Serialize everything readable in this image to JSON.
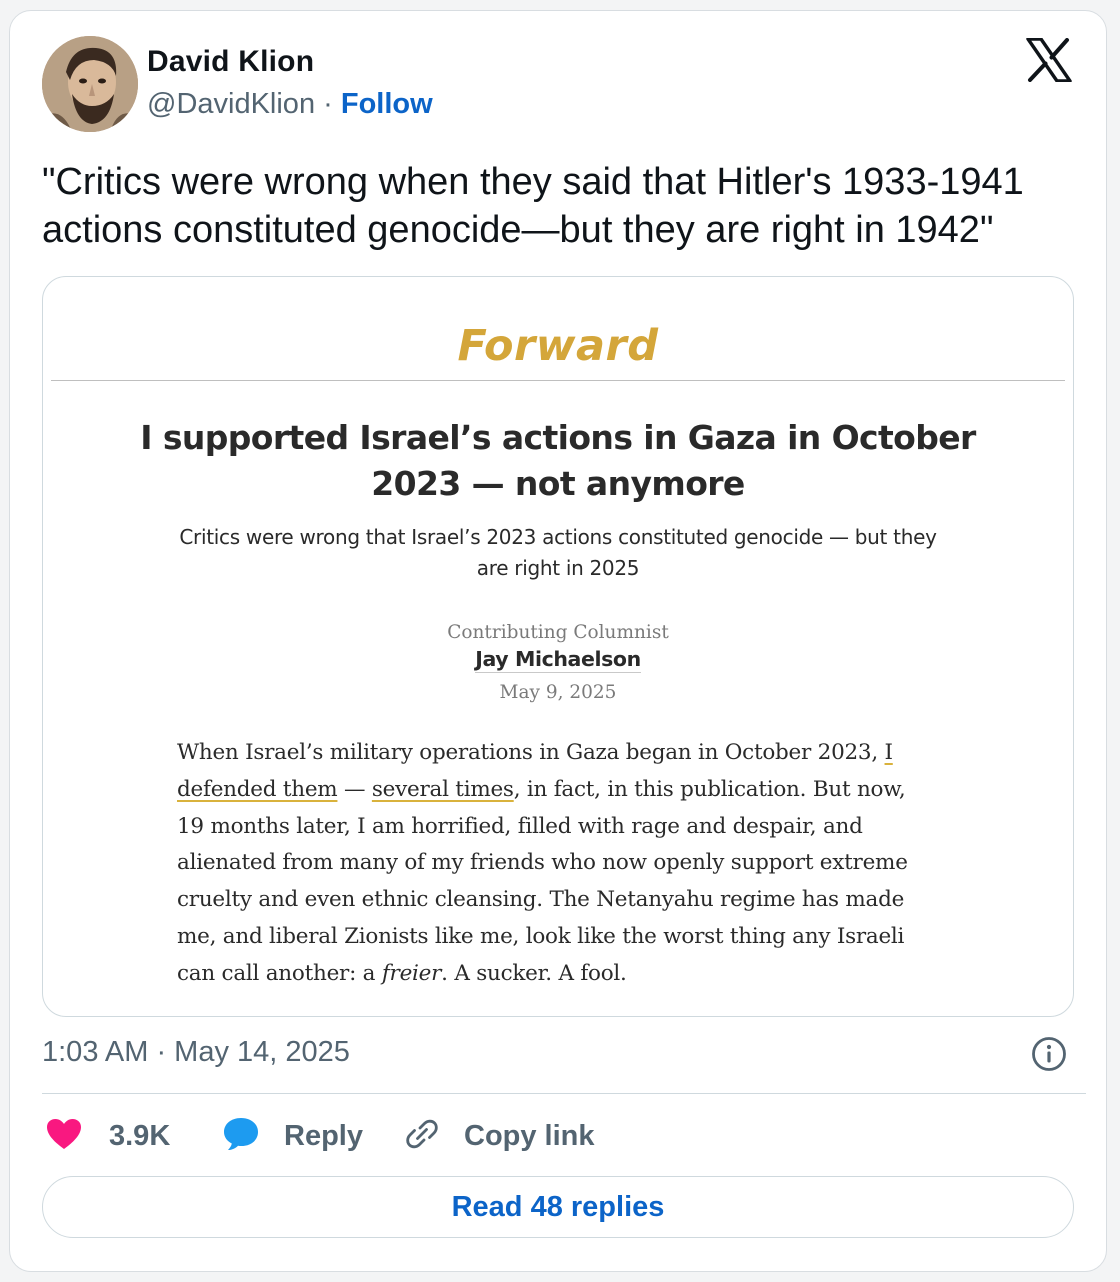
{
  "author": {
    "name": "David Klion",
    "handle": "@DavidKlion",
    "separator": "·",
    "follow_label": "Follow"
  },
  "tweet": {
    "text": "\"Critics were wrong when they said that Hitler's 1933-1941 actions constituted genocide—but they are right in 1942\"",
    "timestamp": "1:03 AM · May 14, 2025"
  },
  "article": {
    "masthead": "Forward",
    "headline": "I supported Israel’s actions in Gaza in October 2023 — not anymore",
    "dek": "Critics were wrong that Israel’s 2023 actions constituted genocide — but they are right in 2025",
    "byline_role": "Contributing Columnist",
    "byline_name": "Jay Michaelson",
    "date": "May 9, 2025",
    "body": {
      "p1": "When Israel’s military operations in Gaza began in October 2023, ",
      "link1": "I defended them",
      "p2": " — ",
      "link2": "several times",
      "p3": ", in fact, in this publication. But now, 19 months later, I am horrified, filled with rage and despair, and alienated from many of my friends who now openly support extreme cruelty and even ethnic cleansing. The Netanyahu regime has made me, and liberal Zionists like me, look like the worst thing any Israeli can call another: a ",
      "em": "freier",
      "p4": ". A sucker. A fool."
    }
  },
  "actions": {
    "like_count": "3.9K",
    "reply_label": "Reply",
    "copy_label": "Copy link",
    "read_replies_label": "Read 48 replies"
  },
  "colors": {
    "accent_blue": "#0c64c8",
    "like_pink": "#f91880",
    "reply_blue": "#1d9bf0",
    "forward_gold": "#d4a63a",
    "muted_gray": "#536471"
  },
  "icons": [
    "x-logo-icon",
    "info-icon",
    "heart-icon",
    "speech-bubble-icon",
    "link-icon"
  ]
}
